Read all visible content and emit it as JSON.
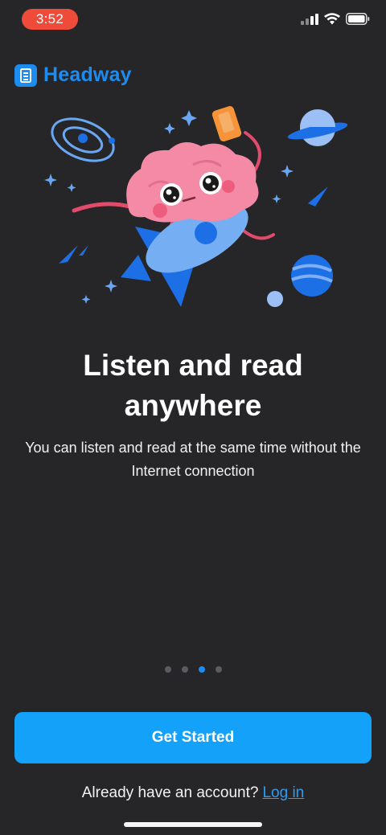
{
  "status_bar": {
    "time": "3:52",
    "icons": [
      "signal-icon",
      "wifi-icon",
      "battery-icon"
    ]
  },
  "brand": {
    "name": "Headway",
    "icon": "book-icon",
    "color": "#1d8cf1"
  },
  "illustration": {
    "subject": "brain-character-riding-rocket",
    "elements": [
      "orbit-icon",
      "planet-icon",
      "phone-icon",
      "star-icon",
      "comet-icon"
    ]
  },
  "onboarding": {
    "headline": "Listen and read anywhere",
    "subtitle": "You can listen and read at the same time without the Internet connection",
    "page_count": 4,
    "active_page": 3
  },
  "actions": {
    "primary_label": "Get Started",
    "account_prompt": "Already have an account?",
    "login_label": "Log in"
  },
  "colors": {
    "background": "#262528",
    "accent": "#13a1fa",
    "status_pill": "#ee4b3b"
  }
}
